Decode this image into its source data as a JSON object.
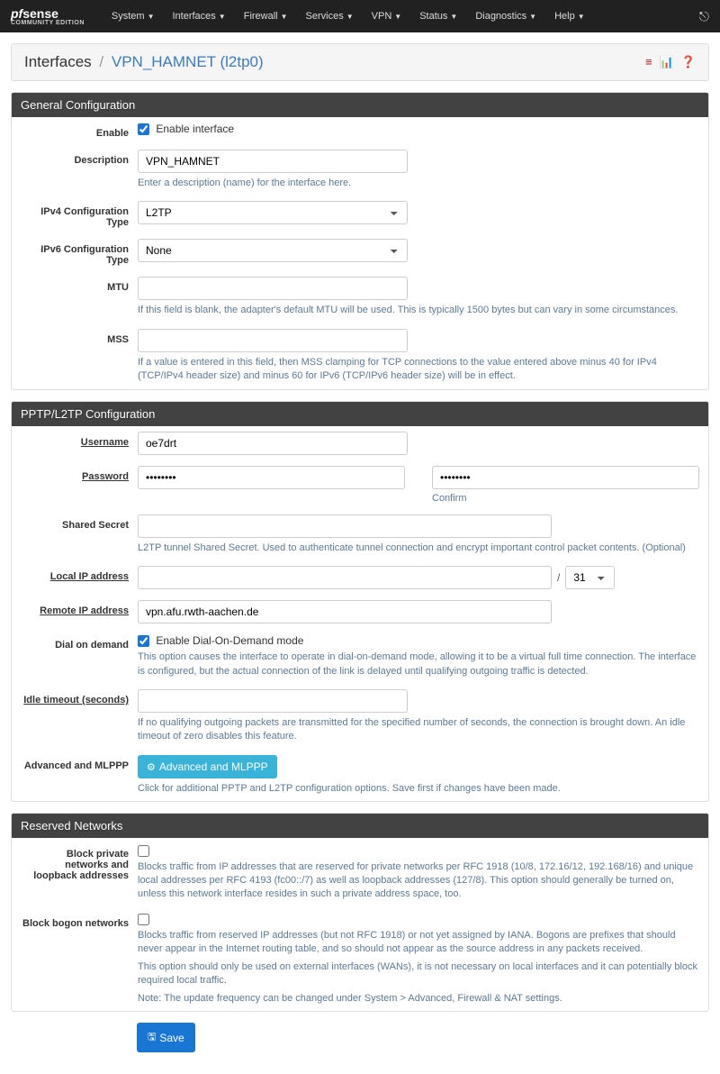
{
  "brand": {
    "name": "pfsense",
    "sub": "COMMUNITY EDITION"
  },
  "nav": [
    "System",
    "Interfaces",
    "Firewall",
    "Services",
    "VPN",
    "Status",
    "Diagnostics",
    "Help"
  ],
  "breadcrumb": {
    "root": "Interfaces",
    "current": "VPN_HAMNET (l2tp0)"
  },
  "panels": {
    "general": {
      "title": "General Configuration",
      "enable": {
        "label": "Enable",
        "checkbox_label": "Enable interface",
        "checked": true
      },
      "description": {
        "label": "Description",
        "value": "VPN_HAMNET",
        "help": "Enter a description (name) for the interface here."
      },
      "ipv4": {
        "label": "IPv4 Configuration Type",
        "value": "L2TP"
      },
      "ipv6": {
        "label": "IPv6 Configuration Type",
        "value": "None"
      },
      "mtu": {
        "label": "MTU",
        "value": "",
        "help": "If this field is blank, the adapter's default MTU will be used. This is typically 1500 bytes but can vary in some circumstances."
      },
      "mss": {
        "label": "MSS",
        "value": "",
        "help": "If a value is entered in this field, then MSS clamping for TCP connections to the value entered above minus 40 for IPv4 (TCP/IPv4 header size) and minus 60 for IPv6 (TCP/IPv6 header size) will be in effect."
      }
    },
    "pptp": {
      "title": "PPTP/L2TP Configuration",
      "username": {
        "label": "Username",
        "value": "oe7drt"
      },
      "password": {
        "label": "Password",
        "value": "••••••••",
        "confirm_value": "••••••••",
        "confirm_label": "Confirm"
      },
      "secret": {
        "label": "Shared Secret",
        "value": "",
        "help": "L2TP tunnel Shared Secret. Used to authenticate tunnel connection and encrypt important control packet contents. (Optional)"
      },
      "local_ip": {
        "label": "Local IP address",
        "value": "",
        "subnet": "31"
      },
      "remote_ip": {
        "label": "Remote IP address",
        "value": "vpn.afu.rwth-aachen.de"
      },
      "dial": {
        "label": "Dial on demand",
        "checkbox_label": "Enable Dial-On-Demand mode",
        "checked": true,
        "help": "This option causes the interface to operate in dial-on-demand mode, allowing it to be a virtual full time connection. The interface is configured, but the actual connection of the link is delayed until qualifying outgoing traffic is detected."
      },
      "idle": {
        "label": "Idle timeout (seconds)",
        "value": "",
        "help": "If no qualifying outgoing packets are transmitted for the specified number of seconds, the connection is brought down. An idle timeout of zero disables this feature."
      },
      "advanced": {
        "label": "Advanced and MLPPP",
        "button": "Advanced and MLPPP",
        "help": "Click for additional PPTP and L2TP configuration options. Save first if changes have been made."
      }
    },
    "reserved": {
      "title": "Reserved Networks",
      "private": {
        "label": "Block private networks and loopback addresses",
        "checked": false,
        "help": "Blocks traffic from IP addresses that are reserved for private networks per RFC 1918 (10/8, 172.16/12, 192.168/16) and unique local addresses per RFC 4193 (fc00::/7) as well as loopback addresses (127/8). This option should generally be turned on, unless this network interface resides in such a private address space, too."
      },
      "bogon": {
        "label": "Block bogon networks",
        "checked": false,
        "help1": "Blocks traffic from reserved IP addresses (but not RFC 1918) or not yet assigned by IANA. Bogons are prefixes that should never appear in the Internet routing table, and so should not appear as the source address in any packets received.",
        "help2": "This option should only be used on external interfaces (WANs), it is not necessary on local interfaces and it can potentially block required local traffic.",
        "help3": "Note: The update frequency can be changed under System > Advanced, Firewall & NAT settings."
      }
    }
  },
  "save_button": "Save"
}
